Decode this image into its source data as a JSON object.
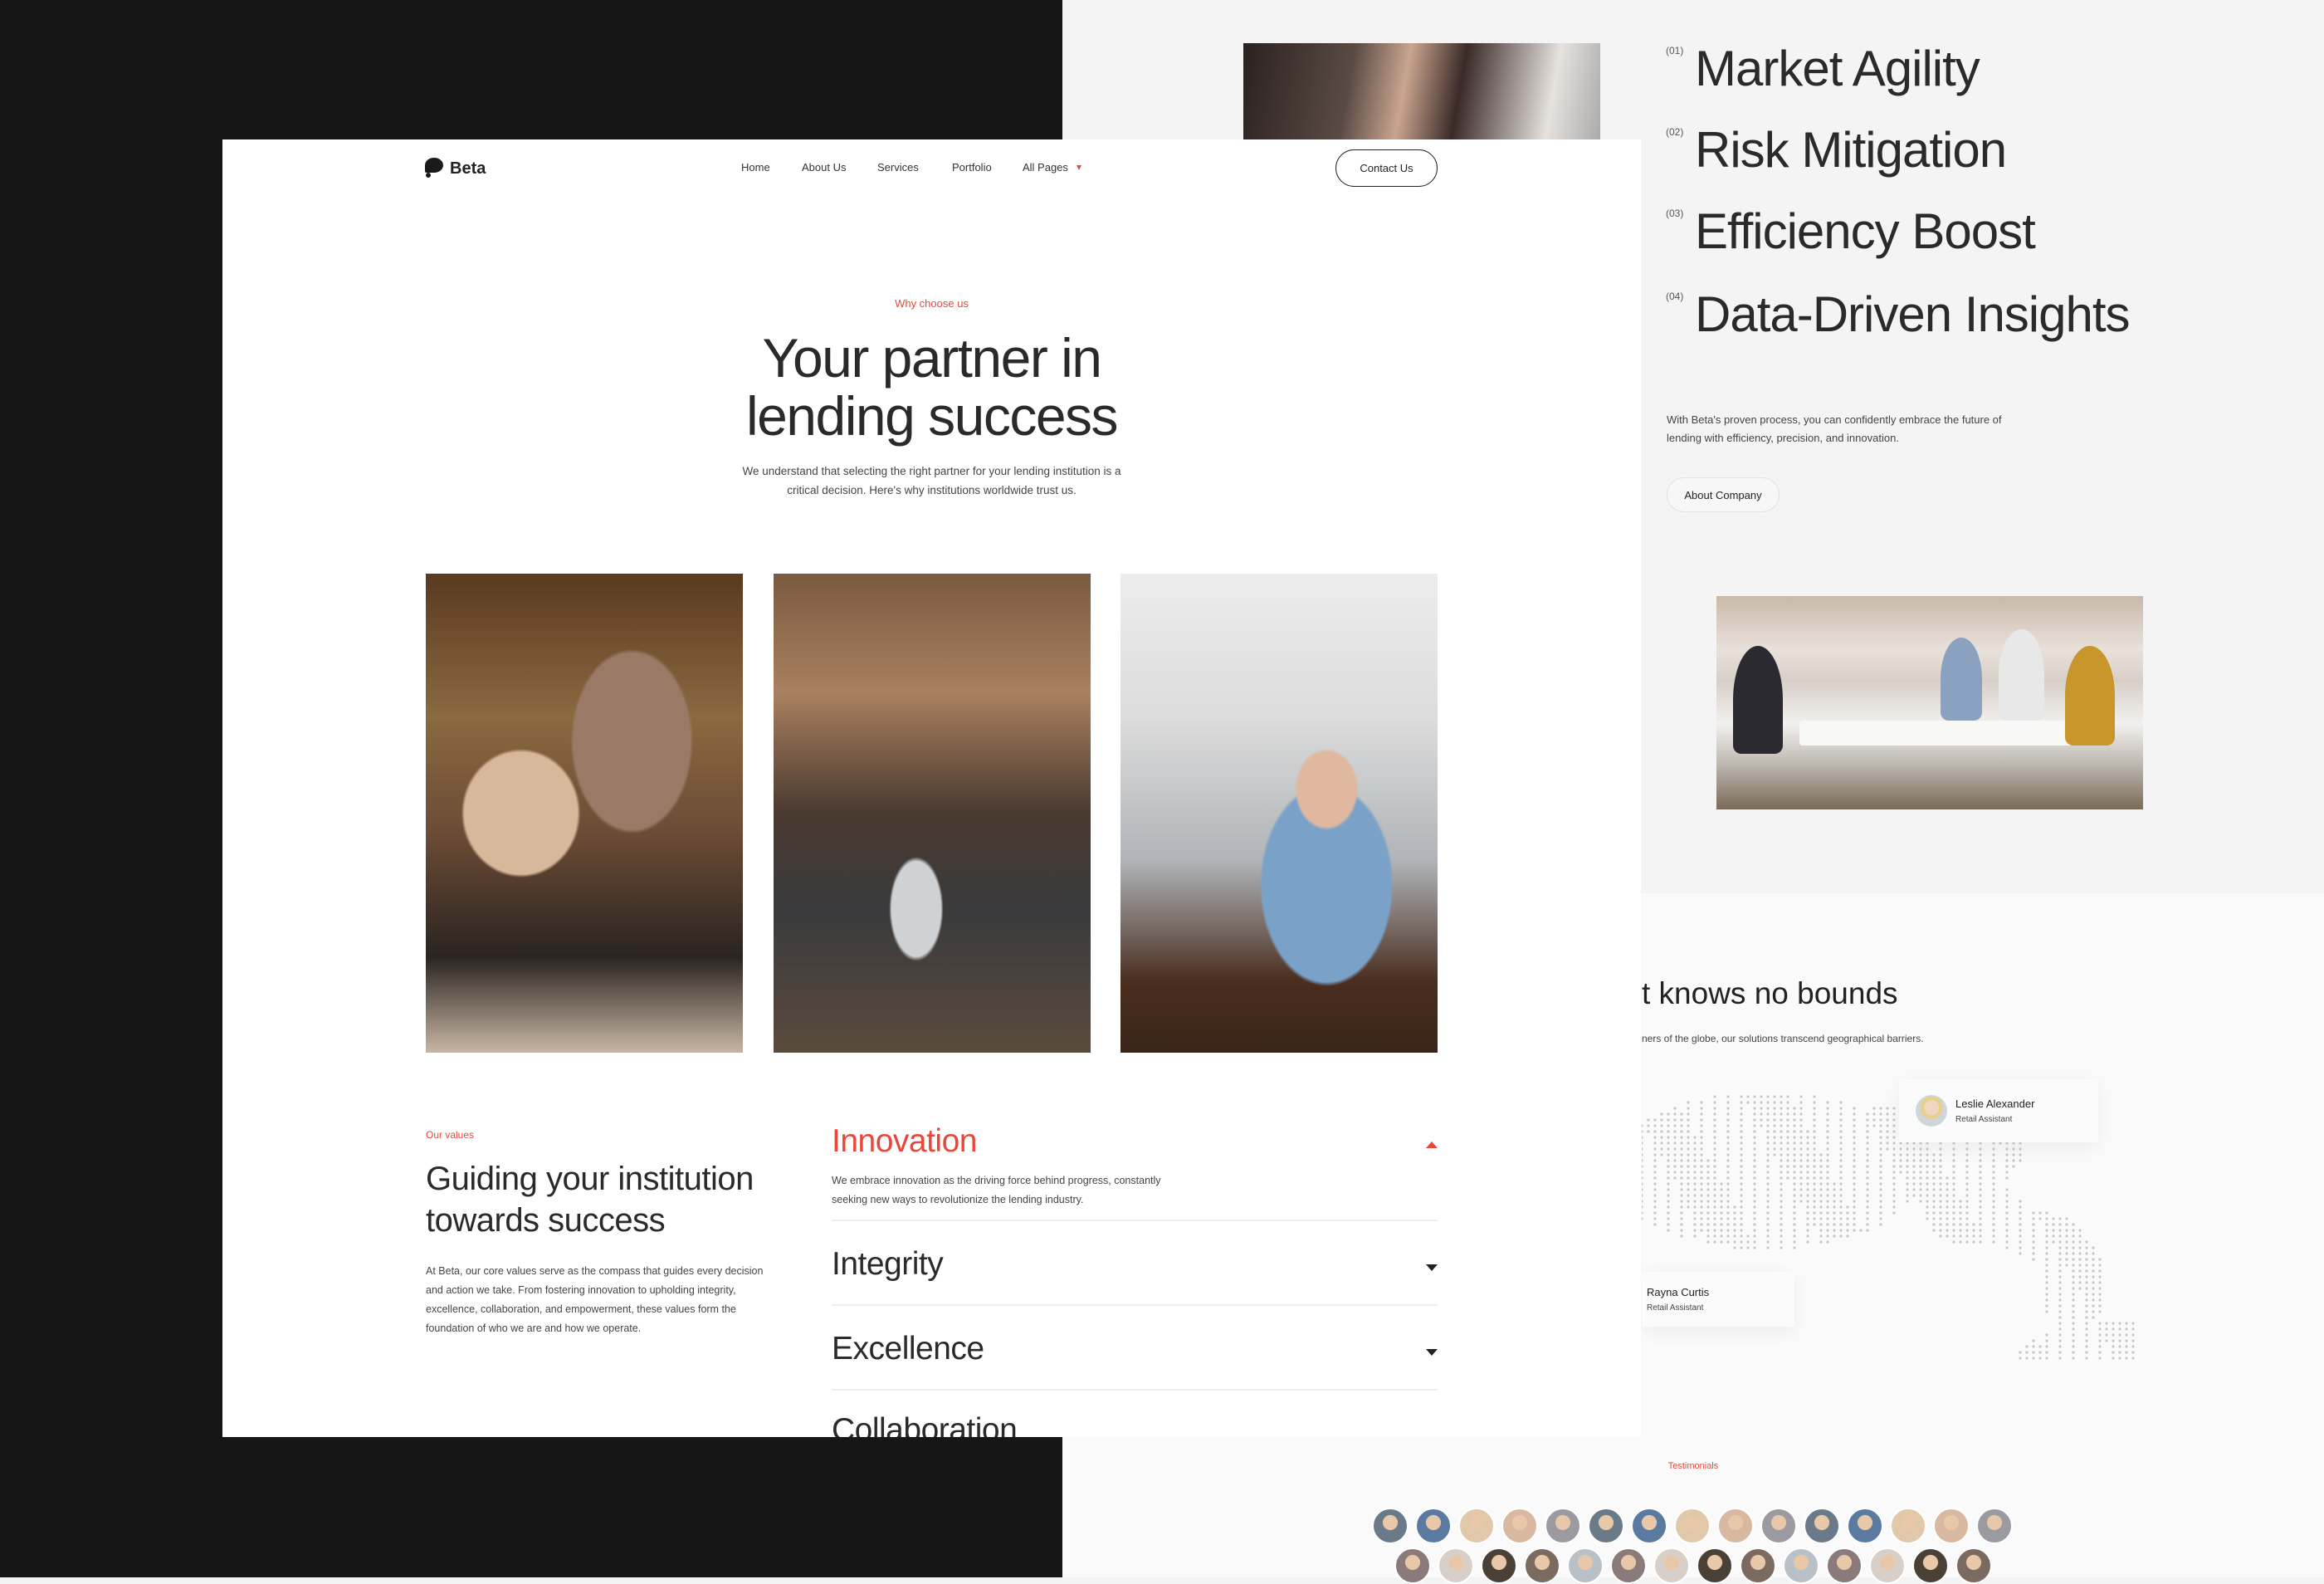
{
  "brand": {
    "name": "Beta",
    "accent": "#e8473a"
  },
  "nav": {
    "items": [
      {
        "label": "Home"
      },
      {
        "label": "About Us"
      },
      {
        "label": "Services"
      },
      {
        "label": "Portfolio"
      },
      {
        "label": "All Pages"
      }
    ],
    "contact": "Contact Us"
  },
  "hero": {
    "eyebrow": "Why choose us",
    "title_line1": "Your partner in",
    "title_line2": "lending success",
    "subtitle_line1": "We understand that selecting the right partner for your lending institution is a",
    "subtitle_line2": "critical decision. Here's why institutions worldwide trust us."
  },
  "values": {
    "eyebrow": "Our values",
    "title": "Guiding your institution towards success",
    "body": "At Beta, our core values serve as the compass that guides every decision and action we take. From fostering innovation to upholding integrity, excellence, collaboration, and empowerment, these values form the foundation of who we are and how we operate.",
    "accordion": [
      {
        "title": "Innovation",
        "open": true,
        "desc": "We embrace innovation as the driving force behind progress, constantly seeking new ways to revolutionize the lending industry."
      },
      {
        "title": "Integrity",
        "open": false
      },
      {
        "title": "Excellence",
        "open": false
      },
      {
        "title": "Collaboration",
        "open": false
      }
    ]
  },
  "features": [
    {
      "num": "(01)",
      "title": "Market Agility"
    },
    {
      "num": "(02)",
      "title": "Risk Mitigation"
    },
    {
      "num": "(03)",
      "title": "Efficiency Boost"
    },
    {
      "num": "(04)",
      "title": "Data-Driven Insights"
    }
  ],
  "process": {
    "text": "With Beta's proven process, you can confidently embrace the future of lending with efficiency, precision, and innovation.",
    "button": "About Company"
  },
  "global": {
    "title": "t knows no bounds",
    "subtitle": "ners of the globe, our solutions transcend geographical barriers.",
    "people": [
      {
        "name": "Leslie Alexander",
        "role": "Retail Assistant"
      },
      {
        "name": "Rayna Curtis",
        "role": "Retail Assistant"
      }
    ]
  },
  "testimonials": {
    "label": "Testimonials"
  }
}
